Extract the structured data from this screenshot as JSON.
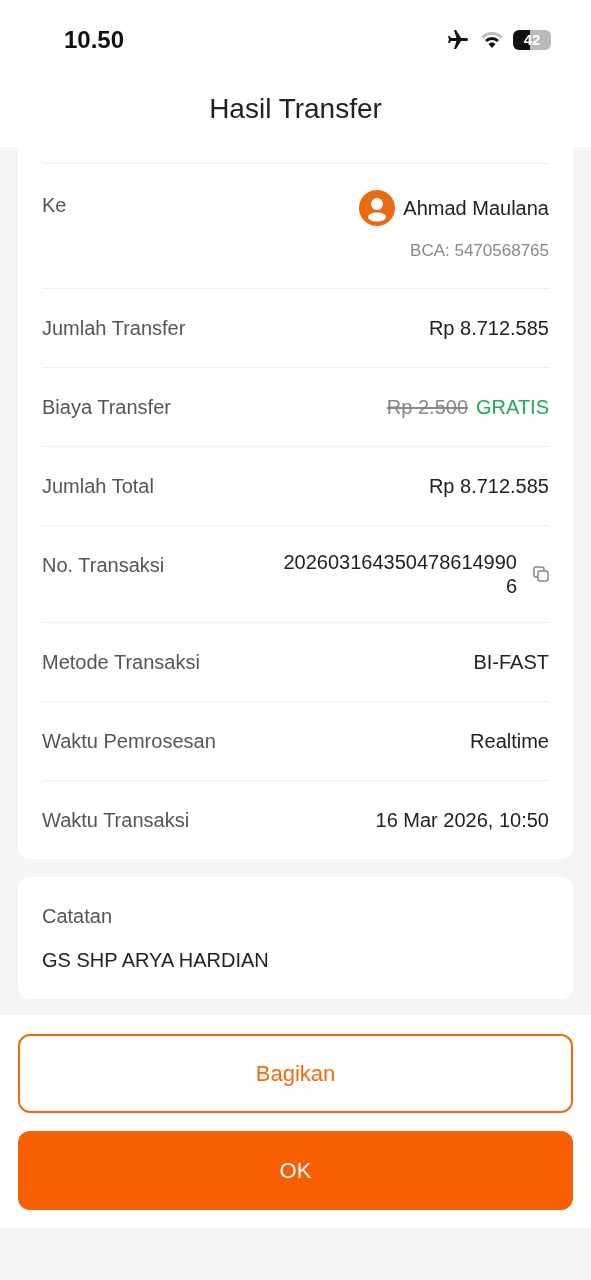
{
  "status_bar": {
    "time": "10.50",
    "battery": "42"
  },
  "header": {
    "title": "Hasil Transfer"
  },
  "details": [
    {
      "kind": "recipient",
      "label": "Ke",
      "name": "Ahmad Maulana",
      "account": "BCA: 5470568765"
    },
    {
      "kind": "plain",
      "label": "Jumlah Transfer",
      "value": "Rp 8.712.585"
    },
    {
      "kind": "fee",
      "label": "Biaya Transfer",
      "old_value": "Rp 2.500",
      "value": "GRATIS"
    },
    {
      "kind": "plain",
      "label": "Jumlah Total",
      "value": "Rp 8.712.585"
    },
    {
      "kind": "copy",
      "label": "No. Transaksi",
      "value": "2026031643504786149906"
    },
    {
      "kind": "plain",
      "label": "Metode Transaksi",
      "value": "BI-FAST"
    },
    {
      "kind": "plain",
      "label": "Waktu Pemrosesan",
      "value": "Realtime"
    },
    {
      "kind": "plain",
      "label": "Waktu Transaksi",
      "value": "16 Mar 2026, 10:50"
    }
  ],
  "note": {
    "label": "Catatan",
    "text": "GS SHP ARYA HARDIAN"
  },
  "buttons": [
    {
      "kind": "outline",
      "label": "Bagikan"
    },
    {
      "kind": "solid",
      "label": "OK"
    }
  ]
}
